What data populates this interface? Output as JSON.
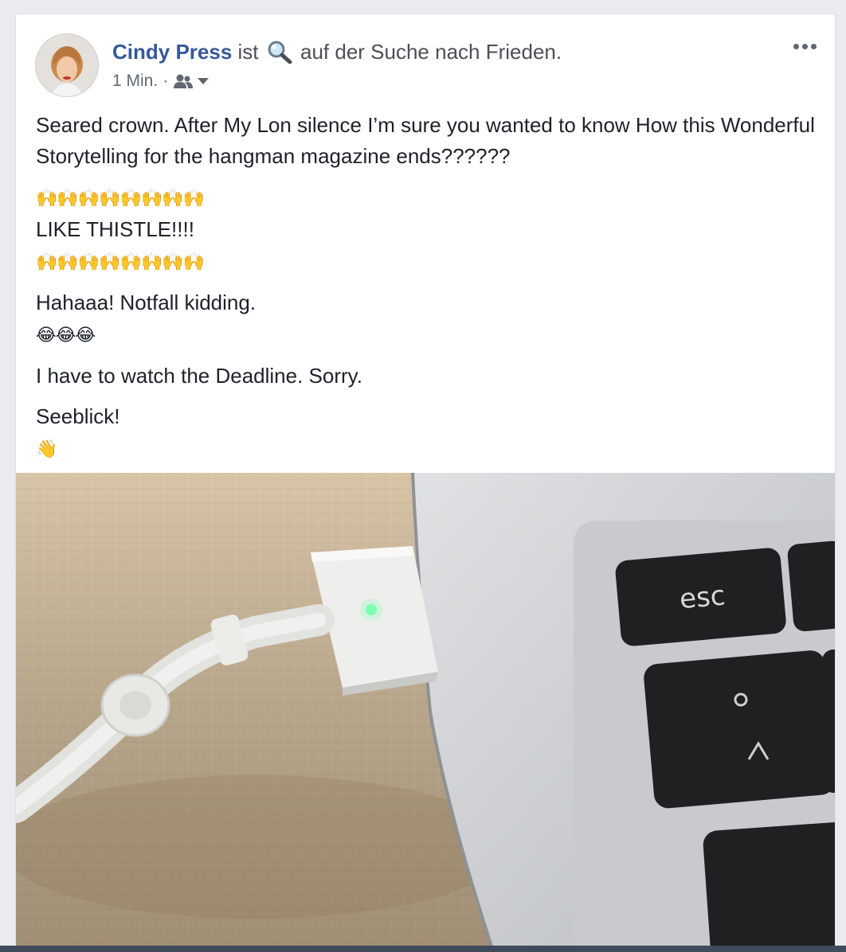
{
  "post": {
    "author": "Cindy Press",
    "activity_verb": "ist",
    "activity_text": "auf der Suche nach Frieden.",
    "activity_icon": "magnifier-icon",
    "timestamp": "1 Min.",
    "separator": "·",
    "audience_icon": "friends-icon",
    "more_icon": "more-options-icon",
    "text": {
      "line1": "Seared crown. After My Lon silence I’m sure you wanted to know How this Wonderful Storytelling for the hangman magazine ends??????",
      "emoji_row_1": "🙌🙌🙌🙌🙌🙌🙌🙌",
      "line2": "LIKE THISTLE!!!!",
      "emoji_row_2": "🙌🙌🙌🙌🙌🙌🙌🙌",
      "line3": "Hahaaa! Notfall kidding.",
      "emoji_row_3": "😂😂😂",
      "line4": "I have to watch the Deadline. Sorry.",
      "line5": "Seeblick!",
      "emoji_row_4": "👋"
    },
    "photo": {
      "key_esc": "esc"
    }
  },
  "colors": {
    "author_link": "#365899",
    "meta_text": "#616770",
    "body_text": "#1d2129",
    "background": "#e9ebee"
  }
}
